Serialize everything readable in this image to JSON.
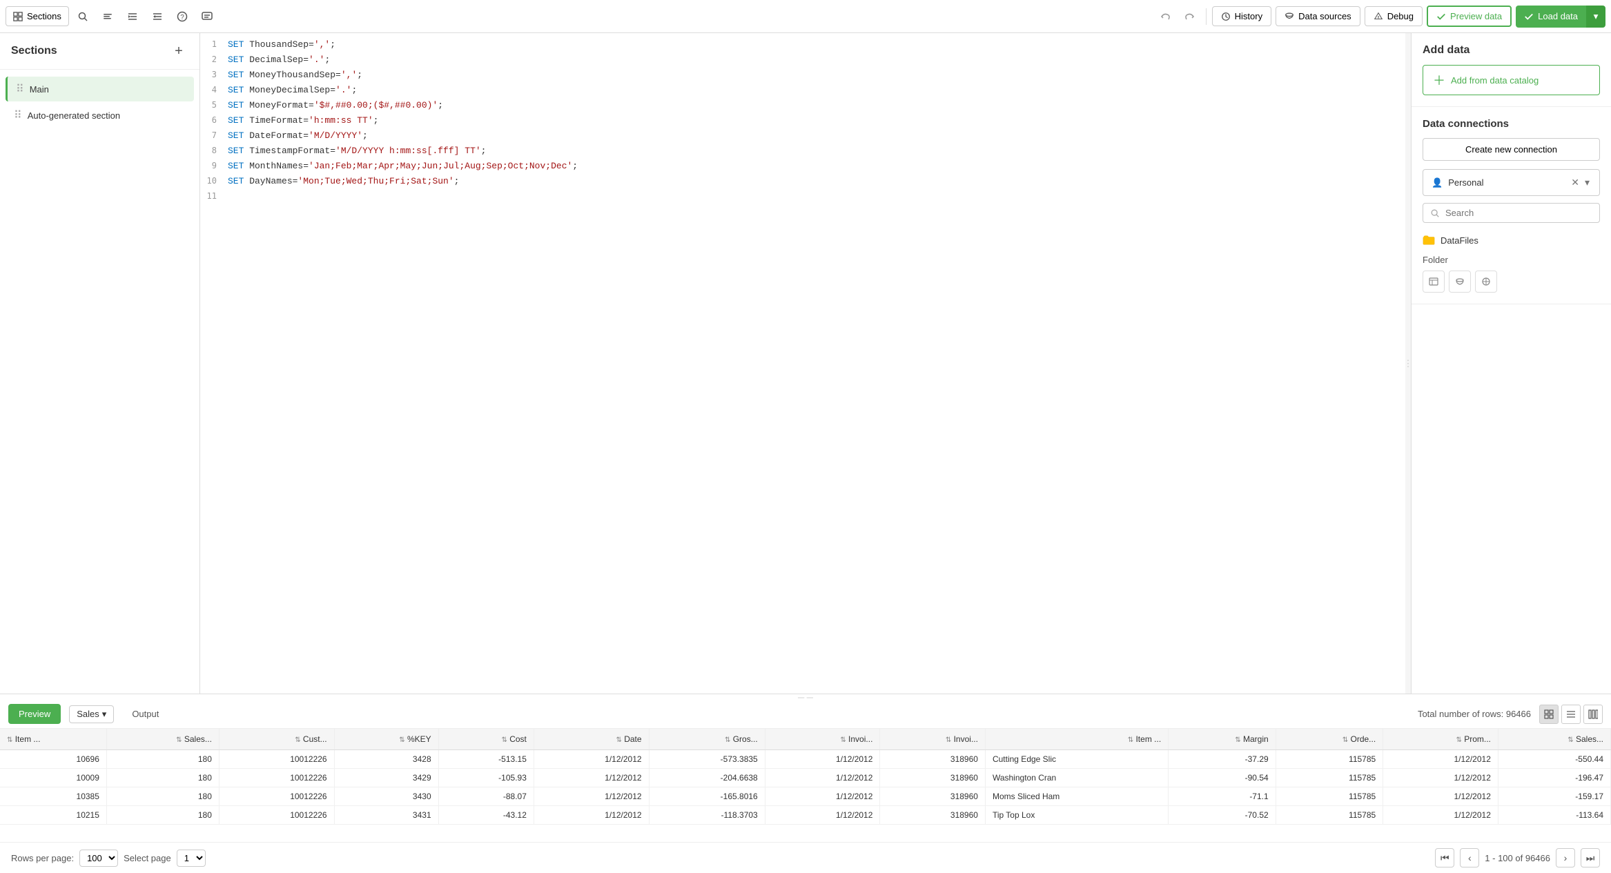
{
  "toolbar": {
    "sections_label": "Sections",
    "history_label": "History",
    "datasources_label": "Data sources",
    "debug_label": "Debug",
    "preview_label": "Preview data",
    "load_label": "Load data"
  },
  "sidebar": {
    "title": "Sections",
    "items": [
      {
        "label": "Main",
        "active": true
      },
      {
        "label": "Auto-generated section",
        "active": false
      }
    ]
  },
  "code_lines": [
    {
      "num": 1,
      "content": "SET ThousandSep=',';"
    },
    {
      "num": 2,
      "content": "SET DecimalSep='.';"
    },
    {
      "num": 3,
      "content": "SET MoneyThousandSep=',';"
    },
    {
      "num": 4,
      "content": "SET MoneyDecimalSep='.';"
    },
    {
      "num": 5,
      "content": "SET MoneyFormat='$#,##0.00;($#,##0.00)';"
    },
    {
      "num": 6,
      "content": "SET TimeFormat='h:mm:ss TT';"
    },
    {
      "num": 7,
      "content": "SET DateFormat='M/D/YYYY';"
    },
    {
      "num": 8,
      "content": "SET TimestampFormat='M/D/YYYY h:mm:ss[.fff] TT';"
    },
    {
      "num": 9,
      "content": "SET MonthNames='Jan;Feb;Mar;Apr;May;Jun;Jul;Aug;Sep;Oct;Nov;Dec';"
    },
    {
      "num": 10,
      "content": "SET DayNames='Mon;Tue;Wed;Thu;Fri;Sat;Sun';"
    },
    {
      "num": 11,
      "content": ""
    }
  ],
  "right_panel": {
    "add_data_title": "Add data",
    "add_catalog_label": "Add from data catalog",
    "connections_title": "Data connections",
    "create_connection_label": "Create new connection",
    "personal_label": "Personal",
    "search_placeholder": "Search",
    "datafiles_label": "DataFiles",
    "folder_label": "Folder"
  },
  "bottom": {
    "preview_tab": "Preview",
    "output_tab": "Output",
    "table_name": "Sales",
    "total_rows_label": "Total number of rows: 96466",
    "rows_per_page_label": "Rows per page:",
    "rows_per_page_value": "100",
    "select_page_label": "Select page",
    "page_value": "1",
    "page_info": "1 - 100 of 96466"
  },
  "table": {
    "columns": [
      "Item ...",
      "Sales...",
      "Cust...",
      "%KEY",
      "Cost",
      "Date",
      "Gros...",
      "Invoi...",
      "Invoi...",
      "Item ...",
      "Margin",
      "Orde...",
      "Prom...",
      "Sales..."
    ],
    "rows": [
      [
        "10696",
        "180",
        "10012226",
        "3428",
        "-513.15",
        "1/12/2012",
        "-573.3835",
        "1/12/2012",
        "318960",
        "Cutting Edge Slic",
        "-37.29",
        "115785",
        "1/12/2012",
        "-550.44"
      ],
      [
        "10009",
        "180",
        "10012226",
        "3429",
        "-105.93",
        "1/12/2012",
        "-204.6638",
        "1/12/2012",
        "318960",
        "Washington Cran",
        "-90.54",
        "115785",
        "1/12/2012",
        "-196.47"
      ],
      [
        "10385",
        "180",
        "10012226",
        "3430",
        "-88.07",
        "1/12/2012",
        "-165.8016",
        "1/12/2012",
        "318960",
        "Moms Sliced Ham",
        "-71.1",
        "115785",
        "1/12/2012",
        "-159.17"
      ],
      [
        "10215",
        "180",
        "10012226",
        "3431",
        "-43.12",
        "1/12/2012",
        "-118.3703",
        "1/12/2012",
        "318960",
        "Tip Top Lox",
        "-70.52",
        "115785",
        "1/12/2012",
        "-113.64"
      ]
    ]
  }
}
